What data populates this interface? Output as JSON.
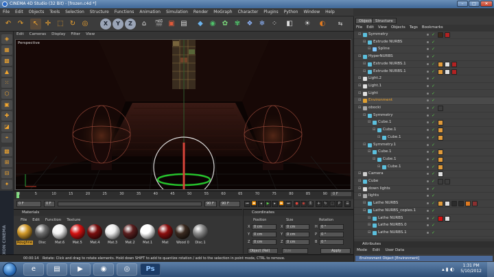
{
  "app": {
    "title": "CINEMA 4D Studio (32 Bit) - [frozen.c4d *]"
  },
  "menubar": [
    "File",
    "Edit",
    "Objects",
    "Tools",
    "Selection",
    "Structure",
    "Functions",
    "Animation",
    "Simulation",
    "Render",
    "MoGraph",
    "Character",
    "Plugins",
    "Python",
    "Window",
    "Help"
  ],
  "viewport": {
    "menu": [
      "Edit",
      "Cameras",
      "Display",
      "Filter",
      "View"
    ],
    "label": "Perspective"
  },
  "toolbar": {
    "axis_x": "X",
    "axis_y": "Y",
    "axis_z": "Z"
  },
  "timeline": {
    "ticks": [
      "0",
      "5",
      "10",
      "15",
      "20",
      "25",
      "30",
      "35",
      "40",
      "45",
      "50",
      "55",
      "60",
      "65",
      "70",
      "75",
      "80",
      "85",
      "90"
    ],
    "end_label": "0 F",
    "start_field": "0 F",
    "current_field": "0 F",
    "end_field": "90 F",
    "end_field2": "90 F"
  },
  "materials": {
    "title": "Materials",
    "menu": [
      "File",
      "Edit",
      "Function",
      "Texture"
    ],
    "items": [
      {
        "label": "Roughne",
        "color": "#d29a2a"
      },
      {
        "label": "Disc",
        "color": "#6d6d6d"
      },
      {
        "label": "Mat.6",
        "color": "#f2f2f2"
      },
      {
        "label": "Mat.5",
        "color": "#d41212"
      },
      {
        "label": "Mat.4",
        "color": "#7a0f0f"
      },
      {
        "label": "Mat.3",
        "color": "#ececec"
      },
      {
        "label": "Mat.2",
        "color": "#5a1e1e"
      },
      {
        "label": "Mat.1",
        "color": "#ffffff"
      },
      {
        "label": "Mat",
        "color": "#8c1010"
      },
      {
        "label": "Wood 0",
        "color": "#3a2a20"
      },
      {
        "label": "Disc.1",
        "color": "#8a8a8a"
      }
    ]
  },
  "coordinates": {
    "title": "Coordinates",
    "headers": [
      "Position",
      "Size",
      "Rotation"
    ],
    "rows": [
      {
        "axis": "X",
        "pos": "0 cm",
        "size_axis": "X",
        "size": "0 cm",
        "rot_axis": "H",
        "rot": "0 °"
      },
      {
        "axis": "Y",
        "pos": "0 cm",
        "size_axis": "Y",
        "size": "0 cm",
        "rot_axis": "P",
        "rot": "0 °"
      },
      {
        "axis": "Z",
        "pos": "0 cm",
        "size_axis": "Z",
        "size": "0 cm",
        "rot_axis": "B",
        "rot": "0 °"
      }
    ],
    "mode": "Object (Rel)",
    "size_mode": "Size",
    "apply": "Apply"
  },
  "status": {
    "time": "00:00:14",
    "message": "Rotate: Click and drag to rotate elements. Hold down SHIFT to add to quantize rotation / add to the selection in point mode, CTRL to remove."
  },
  "sidelogo": "MAXON CINEMA 4D",
  "objects_panel": {
    "tabs": [
      "Objects",
      "Structure"
    ],
    "menu": [
      "File",
      "Edit",
      "View",
      "Objects",
      "Tags",
      "Bookmarks"
    ],
    "rows": [
      {
        "name": "Symmetry",
        "indent": 0,
        "icon": "#5bc0de",
        "tags": [
          "#3d2a1a",
          "#b22222"
        ]
      },
      {
        "name": "Extrude NURBS",
        "indent": 1,
        "icon": "#5bc0de",
        "tags": []
      },
      {
        "name": "Spline",
        "indent": 2,
        "icon": "#7fc7ff",
        "tags": []
      },
      {
        "name": "HyperNURBS",
        "indent": 0,
        "icon": "#5bc0de",
        "tags": []
      },
      {
        "name": "Extrude NURBS.1",
        "indent": 1,
        "icon": "#5bc0de",
        "tags": [
          "#e09a3a",
          "#e0e0e0",
          "#b22222"
        ]
      },
      {
        "name": "Extrude NURBS.1",
        "indent": 1,
        "icon": "#5bc0de",
        "tags": [
          "#e09a3a",
          "#e0e0e0",
          "#b22222"
        ]
      },
      {
        "name": "Light.2",
        "indent": 0,
        "icon": "#e0e0e0",
        "tags": []
      },
      {
        "name": "Light.1",
        "indent": 0,
        "icon": "#e0e0e0",
        "tags": []
      },
      {
        "name": "Light",
        "indent": 0,
        "icon": "#e0e0e0",
        "tags": []
      },
      {
        "name": "Environment",
        "indent": 0,
        "icon": "#e0a030",
        "tags": []
      },
      {
        "name": "obocki",
        "indent": 0,
        "icon": "#aaaaaa",
        "tags": [
          "#3d3d3d"
        ]
      },
      {
        "name": "Symmetry",
        "indent": 1,
        "icon": "#5bc0de",
        "tags": []
      },
      {
        "name": "Cube.1",
        "indent": 2,
        "icon": "#5bc0de",
        "tags": [
          "#e09a3a"
        ]
      },
      {
        "name": "Cube.1",
        "indent": 3,
        "icon": "#5bc0de",
        "tags": [
          "#e09a3a"
        ]
      },
      {
        "name": "Cube.1",
        "indent": 4,
        "icon": "#5bc0de",
        "tags": [
          "#e09a3a"
        ]
      },
      {
        "name": "Symmetry.1",
        "indent": 1,
        "icon": "#5bc0de",
        "tags": []
      },
      {
        "name": "Cube.1",
        "indent": 2,
        "icon": "#5bc0de",
        "tags": [
          "#e09a3a"
        ]
      },
      {
        "name": "Cube.1",
        "indent": 3,
        "icon": "#5bc0de",
        "tags": [
          "#e09a3a"
        ]
      },
      {
        "name": "Cube.1",
        "indent": 4,
        "icon": "#5bc0de",
        "tags": [
          "#e09a3a"
        ]
      },
      {
        "name": "Camera",
        "indent": 0,
        "icon": "#cfcfcf",
        "tags": [
          "#e0e0e0"
        ]
      },
      {
        "name": "Cube",
        "indent": 0,
        "icon": "#5bc0de",
        "tags": [
          "#3d3d3d",
          "#3d3d3d"
        ]
      },
      {
        "name": "down lights",
        "indent": 0,
        "icon": "#e0e0e0",
        "tags": []
      },
      {
        "name": "lights",
        "indent": 0,
        "icon": "#aaaaaa",
        "tags": []
      },
      {
        "name": "Lathe NURBS",
        "indent": 1,
        "icon": "#5bc0de",
        "tags": [
          "#e09a3a",
          "#e0e0e0",
          "#2b2b2b",
          "#2b2b2b",
          "#e07a20",
          "#8a3030"
        ]
      },
      {
        "name": "Lathe NURBS_copies.1",
        "indent": 1,
        "icon": "#5bc0de",
        "tags": []
      },
      {
        "name": "Lathe NURBS",
        "indent": 2,
        "icon": "#5bc0de",
        "tags": [
          "#d41212",
          "#e0e0e0"
        ]
      },
      {
        "name": "Lathe NURBS.0",
        "indent": 2,
        "icon": "#5bc0de",
        "tags": []
      },
      {
        "name": "Lathe NURBS.1",
        "indent": 2,
        "icon": "#5bc0de",
        "tags": []
      }
    ]
  },
  "attributes": {
    "title": "Attributes",
    "menu": [
      "Mode",
      "Edit",
      "User Data"
    ],
    "object_line": "Environment Object [Environment]"
  },
  "taskbar": {
    "time": "1:31 PM",
    "date": "5/10/2012",
    "ps_label": "Ps"
  }
}
